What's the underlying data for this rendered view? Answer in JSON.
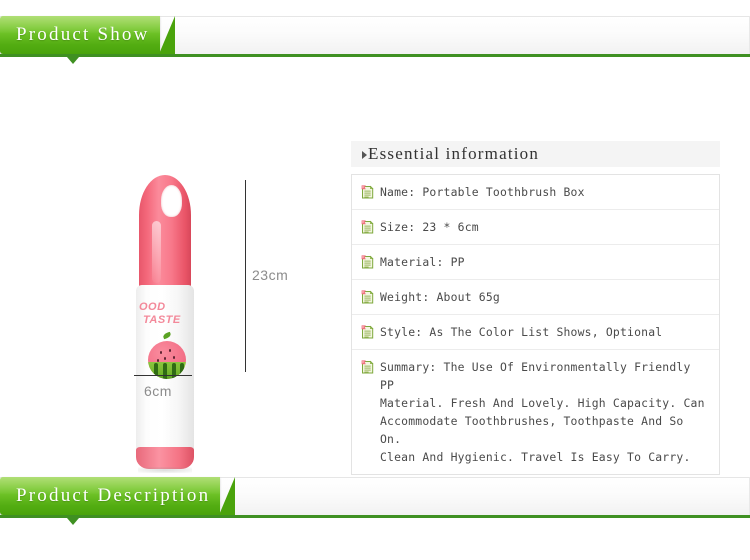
{
  "sections": {
    "show_banner": {
      "label": "Product Show",
      "notch_icon": "triangle-down-icon"
    },
    "description_banner": {
      "label": "Product Description",
      "notch_icon": "triangle-down-icon"
    }
  },
  "product": {
    "label_line1": "OOD",
    "label_line2": "TASTE",
    "dimension_height": "23cm",
    "dimension_width": "6cm",
    "graphic": "watermelon-illustration"
  },
  "info_panel": {
    "title": "Essential information",
    "caret_icon": "caret-right-icon",
    "row_icon": "note-document-icon",
    "rows": [
      {
        "text": "Name: Portable Toothbrush Box"
      },
      {
        "text": "Size: 23 * 6cm"
      },
      {
        "text": "Material: PP"
      },
      {
        "text": "Weight: About 65g"
      },
      {
        "text": "Style: As The Color List Shows, Optional"
      },
      {
        "text": "Summary: The Use Of Environmentally Friendly PP\nMaterial. Fresh And Lovely. High Capacity. Can\nAccommodate Toothbrushes, Toothpaste And So On.\nClean And Hygienic. Travel Is Easy To Carry."
      }
    ]
  },
  "colors": {
    "banner_green": "#4aa30c",
    "banner_rule": "#3f9022",
    "product_pink": "#f4738a",
    "watermelon_green": "#6fb32a",
    "dimension_text": "#8c8c8c"
  }
}
